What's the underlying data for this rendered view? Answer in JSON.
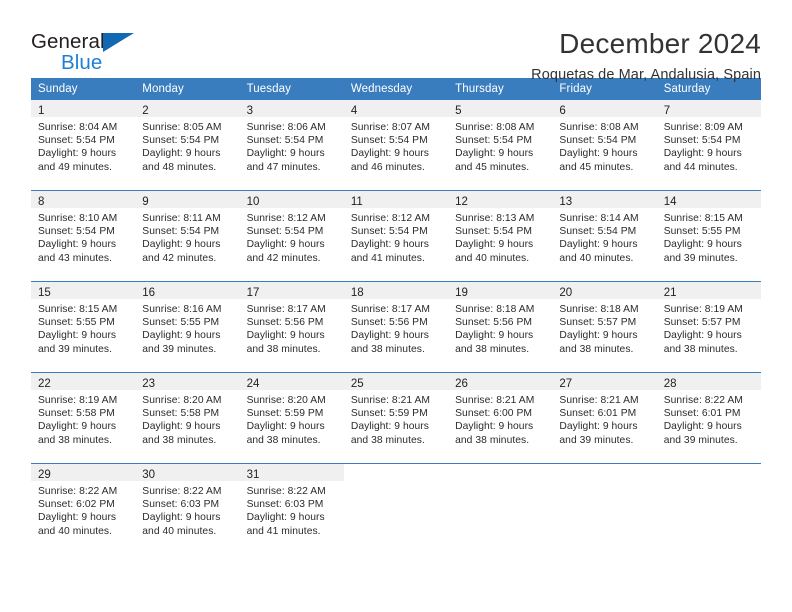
{
  "brand": {
    "word1": "General",
    "word2": "Blue",
    "triangle_color": "#1268b3",
    "word2_color": "#1f7fd4"
  },
  "header": {
    "title": "December 2024",
    "subtitle": "Roquetas de Mar, Andalusia, Spain"
  },
  "theme": {
    "header_blue": "#3a7dbf",
    "daynum_band": "#f0f0f0",
    "text": "#2b2b2b"
  },
  "calendar": {
    "weekday_headers": [
      "Sunday",
      "Monday",
      "Tuesday",
      "Wednesday",
      "Thursday",
      "Friday",
      "Saturday"
    ],
    "weeks": [
      [
        {
          "day": "1",
          "lines": [
            "Sunrise: 8:04 AM",
            "Sunset: 5:54 PM",
            "Daylight: 9 hours",
            "and 49 minutes."
          ]
        },
        {
          "day": "2",
          "lines": [
            "Sunrise: 8:05 AM",
            "Sunset: 5:54 PM",
            "Daylight: 9 hours",
            "and 48 minutes."
          ]
        },
        {
          "day": "3",
          "lines": [
            "Sunrise: 8:06 AM",
            "Sunset: 5:54 PM",
            "Daylight: 9 hours",
            "and 47 minutes."
          ]
        },
        {
          "day": "4",
          "lines": [
            "Sunrise: 8:07 AM",
            "Sunset: 5:54 PM",
            "Daylight: 9 hours",
            "and 46 minutes."
          ]
        },
        {
          "day": "5",
          "lines": [
            "Sunrise: 8:08 AM",
            "Sunset: 5:54 PM",
            "Daylight: 9 hours",
            "and 45 minutes."
          ]
        },
        {
          "day": "6",
          "lines": [
            "Sunrise: 8:08 AM",
            "Sunset: 5:54 PM",
            "Daylight: 9 hours",
            "and 45 minutes."
          ]
        },
        {
          "day": "7",
          "lines": [
            "Sunrise: 8:09 AM",
            "Sunset: 5:54 PM",
            "Daylight: 9 hours",
            "and 44 minutes."
          ]
        }
      ],
      [
        {
          "day": "8",
          "lines": [
            "Sunrise: 8:10 AM",
            "Sunset: 5:54 PM",
            "Daylight: 9 hours",
            "and 43 minutes."
          ]
        },
        {
          "day": "9",
          "lines": [
            "Sunrise: 8:11 AM",
            "Sunset: 5:54 PM",
            "Daylight: 9 hours",
            "and 42 minutes."
          ]
        },
        {
          "day": "10",
          "lines": [
            "Sunrise: 8:12 AM",
            "Sunset: 5:54 PM",
            "Daylight: 9 hours",
            "and 42 minutes."
          ]
        },
        {
          "day": "11",
          "lines": [
            "Sunrise: 8:12 AM",
            "Sunset: 5:54 PM",
            "Daylight: 9 hours",
            "and 41 minutes."
          ]
        },
        {
          "day": "12",
          "lines": [
            "Sunrise: 8:13 AM",
            "Sunset: 5:54 PM",
            "Daylight: 9 hours",
            "and 40 minutes."
          ]
        },
        {
          "day": "13",
          "lines": [
            "Sunrise: 8:14 AM",
            "Sunset: 5:54 PM",
            "Daylight: 9 hours",
            "and 40 minutes."
          ]
        },
        {
          "day": "14",
          "lines": [
            "Sunrise: 8:15 AM",
            "Sunset: 5:55 PM",
            "Daylight: 9 hours",
            "and 39 minutes."
          ]
        }
      ],
      [
        {
          "day": "15",
          "lines": [
            "Sunrise: 8:15 AM",
            "Sunset: 5:55 PM",
            "Daylight: 9 hours",
            "and 39 minutes."
          ]
        },
        {
          "day": "16",
          "lines": [
            "Sunrise: 8:16 AM",
            "Sunset: 5:55 PM",
            "Daylight: 9 hours",
            "and 39 minutes."
          ]
        },
        {
          "day": "17",
          "lines": [
            "Sunrise: 8:17 AM",
            "Sunset: 5:56 PM",
            "Daylight: 9 hours",
            "and 38 minutes."
          ]
        },
        {
          "day": "18",
          "lines": [
            "Sunrise: 8:17 AM",
            "Sunset: 5:56 PM",
            "Daylight: 9 hours",
            "and 38 minutes."
          ]
        },
        {
          "day": "19",
          "lines": [
            "Sunrise: 8:18 AM",
            "Sunset: 5:56 PM",
            "Daylight: 9 hours",
            "and 38 minutes."
          ]
        },
        {
          "day": "20",
          "lines": [
            "Sunrise: 8:18 AM",
            "Sunset: 5:57 PM",
            "Daylight: 9 hours",
            "and 38 minutes."
          ]
        },
        {
          "day": "21",
          "lines": [
            "Sunrise: 8:19 AM",
            "Sunset: 5:57 PM",
            "Daylight: 9 hours",
            "and 38 minutes."
          ]
        }
      ],
      [
        {
          "day": "22",
          "lines": [
            "Sunrise: 8:19 AM",
            "Sunset: 5:58 PM",
            "Daylight: 9 hours",
            "and 38 minutes."
          ]
        },
        {
          "day": "23",
          "lines": [
            "Sunrise: 8:20 AM",
            "Sunset: 5:58 PM",
            "Daylight: 9 hours",
            "and 38 minutes."
          ]
        },
        {
          "day": "24",
          "lines": [
            "Sunrise: 8:20 AM",
            "Sunset: 5:59 PM",
            "Daylight: 9 hours",
            "and 38 minutes."
          ]
        },
        {
          "day": "25",
          "lines": [
            "Sunrise: 8:21 AM",
            "Sunset: 5:59 PM",
            "Daylight: 9 hours",
            "and 38 minutes."
          ]
        },
        {
          "day": "26",
          "lines": [
            "Sunrise: 8:21 AM",
            "Sunset: 6:00 PM",
            "Daylight: 9 hours",
            "and 38 minutes."
          ]
        },
        {
          "day": "27",
          "lines": [
            "Sunrise: 8:21 AM",
            "Sunset: 6:01 PM",
            "Daylight: 9 hours",
            "and 39 minutes."
          ]
        },
        {
          "day": "28",
          "lines": [
            "Sunrise: 8:22 AM",
            "Sunset: 6:01 PM",
            "Daylight: 9 hours",
            "and 39 minutes."
          ]
        }
      ],
      [
        {
          "day": "29",
          "lines": [
            "Sunrise: 8:22 AM",
            "Sunset: 6:02 PM",
            "Daylight: 9 hours",
            "and 40 minutes."
          ]
        },
        {
          "day": "30",
          "lines": [
            "Sunrise: 8:22 AM",
            "Sunset: 6:03 PM",
            "Daylight: 9 hours",
            "and 40 minutes."
          ]
        },
        {
          "day": "31",
          "lines": [
            "Sunrise: 8:22 AM",
            "Sunset: 6:03 PM",
            "Daylight: 9 hours",
            "and 41 minutes."
          ]
        },
        {
          "day": "",
          "lines": []
        },
        {
          "day": "",
          "lines": []
        },
        {
          "day": "",
          "lines": []
        },
        {
          "day": "",
          "lines": []
        }
      ]
    ]
  }
}
